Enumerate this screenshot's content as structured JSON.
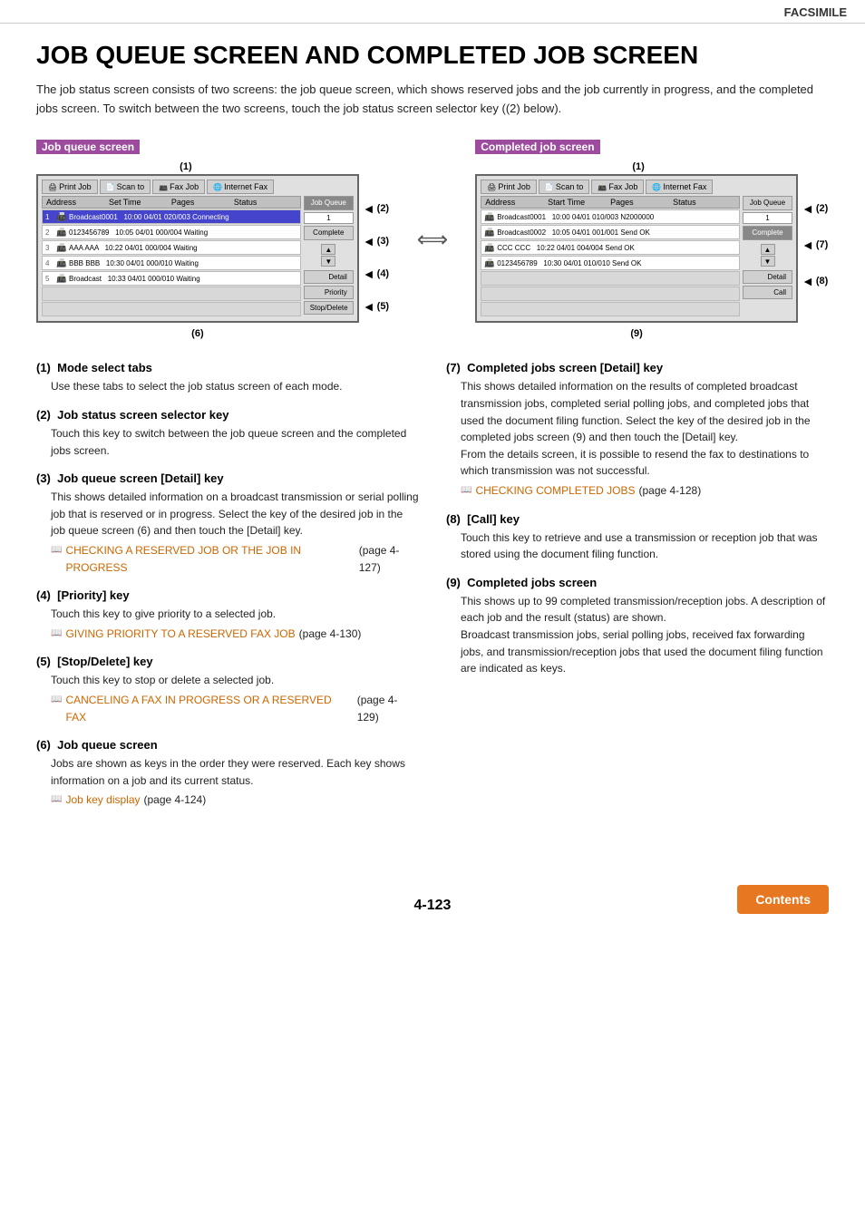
{
  "header": {
    "title": "FACSIMILE"
  },
  "page": {
    "title": "JOB QUEUE SCREEN AND COMPLETED JOB SCREEN",
    "intro": "The job status screen consists of two screens: the job queue screen, which shows reserved jobs and the job currently in progress, and the completed jobs screen. To switch between the two screens, touch the job status screen selector key ((2) below)."
  },
  "left_screen": {
    "label": "Job queue screen",
    "annotation1": "(1)",
    "annotation2": "(2)",
    "annotation3": "(3)",
    "annotation4": "(4)",
    "annotation5": "(5)",
    "annotation6": "(6)",
    "tabs": [
      "Print Job",
      "Scan to",
      "Fax Job",
      "Internet Fax"
    ],
    "table_header": [
      "Address",
      "Set Time",
      "Pages",
      "Status"
    ],
    "rows": [
      {
        "num": "1",
        "icon": "📠",
        "addr": "Broadcast0001",
        "time": "10:00 04/01 020/003",
        "status": "Connecting"
      },
      {
        "num": "2",
        "icon": "📠",
        "addr": "0123456789",
        "time": "10:05 04/01 000/004",
        "status": "Waiting"
      },
      {
        "num": "3",
        "icon": "📠",
        "addr": "AAA AAA",
        "time": "10:22 04/01 000/004",
        "status": "Waiting"
      },
      {
        "num": "4",
        "icon": "📠",
        "addr": "BBB BBB",
        "time": "10:30 04/01 000/010",
        "status": "Waiting"
      },
      {
        "num": "5",
        "icon": "📠",
        "addr": "Broadcast",
        "time": "10:33 04/01 000/010",
        "status": "Waiting"
      }
    ],
    "buttons": {
      "job_queue": "Job Queue",
      "complete": "Complete",
      "counter": "1",
      "detail": "Detail",
      "priority": "Priority",
      "stop_delete": "Stop/Delete"
    }
  },
  "right_screen": {
    "label": "Completed job screen",
    "annotation1": "(1)",
    "annotation2": "(2)",
    "annotation7": "(7)",
    "annotation8": "(8)",
    "annotation9": "(9)",
    "tabs": [
      "Print Job",
      "Scan to",
      "Fax Job",
      "Internet Fax"
    ],
    "table_header": [
      "Address",
      "Start Time",
      "Pages",
      "Status"
    ],
    "rows": [
      {
        "num": "",
        "icon": "📠",
        "addr": "Broadcast0001",
        "time": "10:00 04/01 010/003",
        "status": "N2000000"
      },
      {
        "num": "",
        "icon": "📠",
        "addr": "Broadcast0002",
        "time": "10:05 04/01 001/001",
        "status": "Send OK"
      },
      {
        "num": "",
        "icon": "📠",
        "addr": "CCC CCC",
        "time": "10:22 04/01 004/004",
        "status": "Send OK"
      },
      {
        "num": "",
        "icon": "📠",
        "addr": "0123456789",
        "time": "10:30 04/01 010/010",
        "status": "Send OK"
      }
    ],
    "buttons": {
      "job_queue": "Job Queue",
      "complete": "Complete",
      "counter": "1",
      "detail": "Detail",
      "call": "Call"
    }
  },
  "descriptions": {
    "items": [
      {
        "num": "(1)",
        "title": "Mode select tabs",
        "body": "Use these tabs to select the job status screen of each mode."
      },
      {
        "num": "(2)",
        "title": "Job status screen selector key",
        "body": "Touch this key to switch between the job queue screen and the completed jobs screen."
      },
      {
        "num": "(3)",
        "title": "Job queue screen [Detail] key",
        "body": "This shows detailed information on a broadcast transmission or serial polling job that is reserved or in progress. Select the key of the desired job in the job queue screen (6) and then touch the [Detail] key.",
        "link_text": "CHECKING A RESERVED JOB OR THE JOB IN PROGRESS",
        "link_page": "(page 4-127)"
      },
      {
        "num": "(4)",
        "title": "[Priority] key",
        "body": "Touch this key to give priority to a selected job.",
        "link_text": "GIVING PRIORITY TO A RESERVED FAX JOB",
        "link_page": "(page 4-130)"
      },
      {
        "num": "(5)",
        "title": "[Stop/Delete] key",
        "body": "Touch this key to stop or delete a selected job.",
        "link_text": "CANCELING A FAX IN PROGRESS OR A RESERVED FAX",
        "link_page": "(page 4-129)"
      },
      {
        "num": "(6)",
        "title": "Job queue screen",
        "body": "Jobs are shown as keys in the order they were reserved. Each key shows information on a job and its current status.",
        "link_text": "Job key display",
        "link_page": "(page 4-124)"
      },
      {
        "num": "(7)",
        "title": "Completed jobs screen [Detail] key",
        "body": "This shows detailed information on the results of completed broadcast transmission jobs, completed serial polling jobs, and completed jobs that used the document filing function. Select the key of the desired job in the completed jobs screen (9) and then touch the [Detail] key.\nFrom the details screen, it is possible to resend the fax to destinations to which transmission was not successful.",
        "link_text": "CHECKING COMPLETED JOBS",
        "link_page": "(page 4-128)"
      },
      {
        "num": "(8)",
        "title": "[Call] key",
        "body": "Touch this key to retrieve and use a transmission or reception job that was stored using the document filing function."
      },
      {
        "num": "(9)",
        "title": "Completed jobs screen",
        "body": "This shows up to 99 completed transmission/reception jobs. A description of each job and the result (status) are shown.\nBroadcast transmission jobs, serial polling jobs, received fax forwarding jobs, and transmission/reception jobs that used the document filing function are indicated as keys."
      }
    ]
  },
  "footer": {
    "page_number": "4-123",
    "contents_button": "Contents"
  }
}
